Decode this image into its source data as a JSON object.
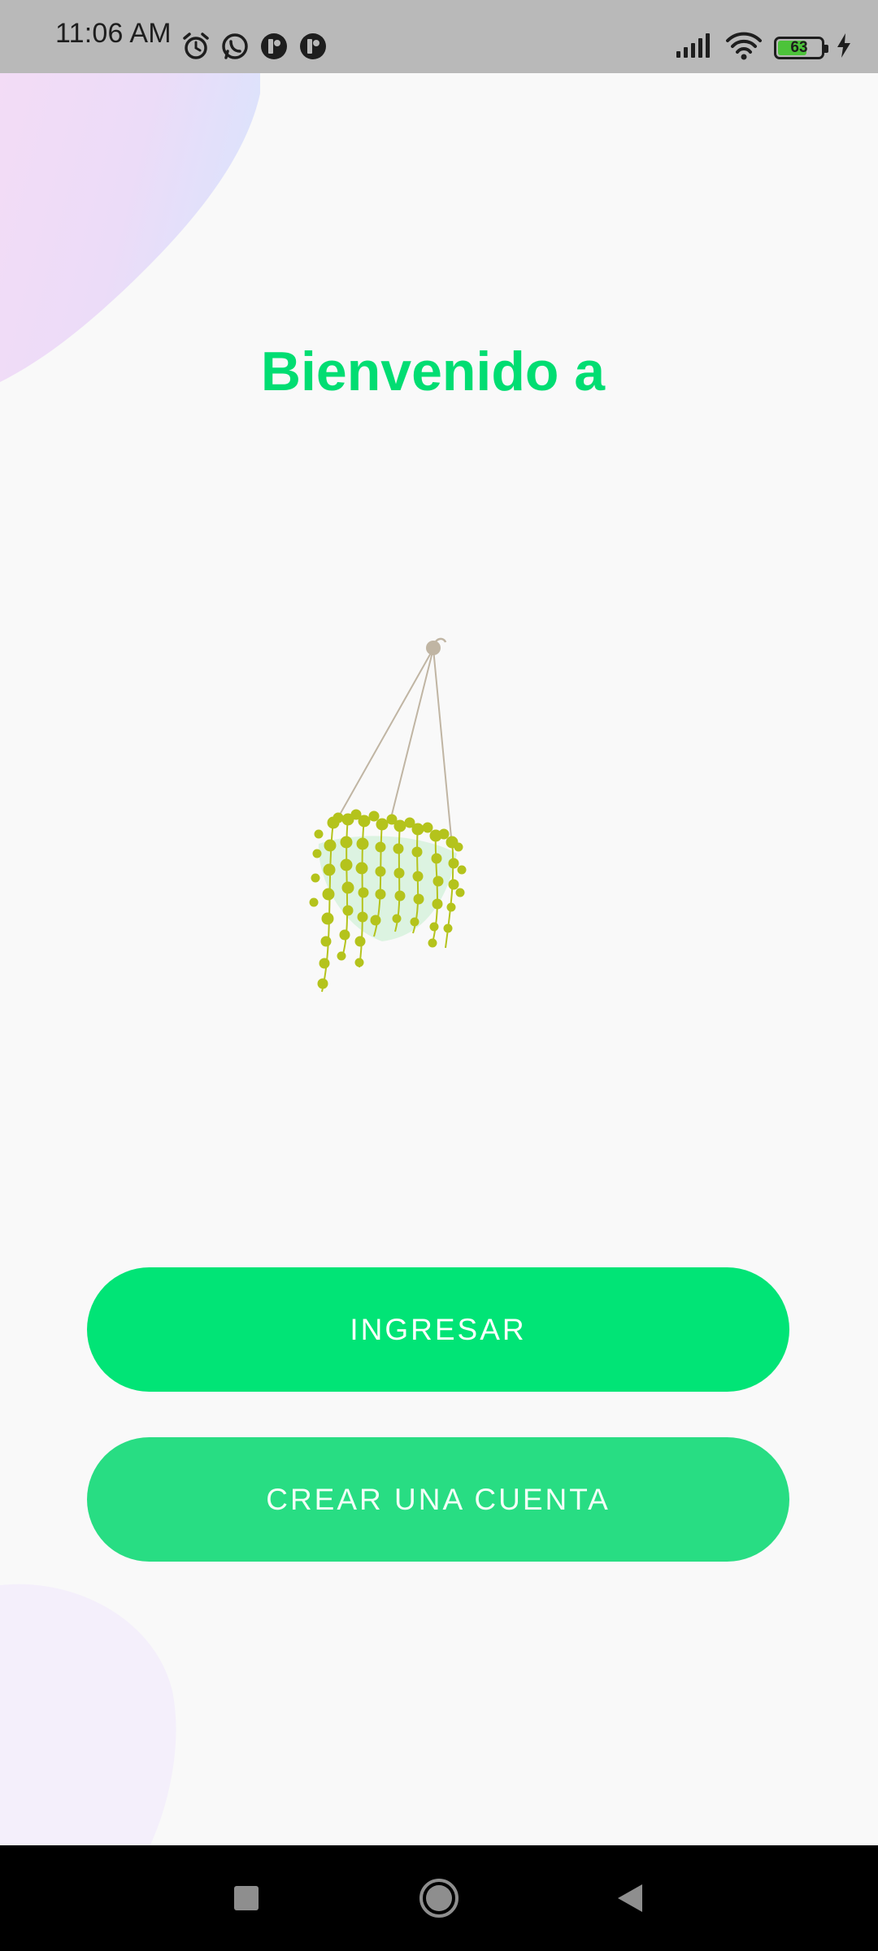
{
  "status_bar": {
    "time": "11:06 AM",
    "battery_level": "63",
    "icons_left": [
      "alarm-icon",
      "whatsapp-icon",
      "app-icon",
      "app-icon"
    ],
    "icons_right": [
      "signal-icon",
      "wifi-icon",
      "battery-icon",
      "charging-icon"
    ]
  },
  "main": {
    "title": "Bienvenido a",
    "login_button": "INGRESAR",
    "register_button": "CREAR UNA CUENTA"
  },
  "navigation": {
    "icons": [
      "recents-icon",
      "home-icon",
      "back-icon"
    ]
  },
  "colors": {
    "accent": "#01dd72",
    "button_primary": "#01e476",
    "button_secondary": "#28dd83",
    "status_bar": "#b9b9b9",
    "background": "#f9f9f9"
  }
}
